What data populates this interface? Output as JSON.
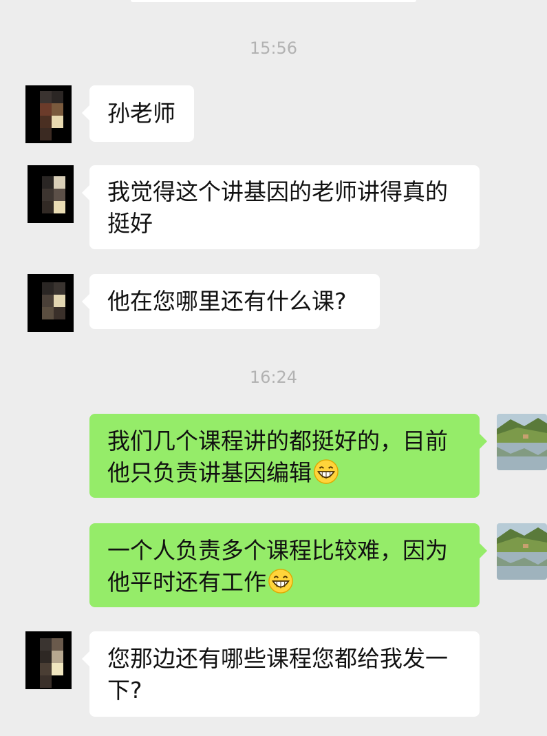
{
  "chat": {
    "timestamps": [
      "15:56",
      "16:24"
    ],
    "messages": [
      {
        "side": "incoming",
        "text": "孙老师"
      },
      {
        "side": "incoming",
        "line1": "我觉得这个讲基因的老师讲得真的",
        "line2": "挺好"
      },
      {
        "side": "incoming",
        "text": "他在您哪里还有什么课?"
      },
      {
        "side": "outgoing",
        "line1": "我们几个课程讲的都挺好的，目前",
        "line2": "他只负责讲基因编辑",
        "emoji": "grinning-face-emoji"
      },
      {
        "side": "outgoing",
        "line1": "一个人负责多个课程比较难，因为",
        "line2": "他平时还有工作",
        "emoji": "grinning-face-emoji"
      },
      {
        "side": "incoming",
        "line1": "您那边还有哪些课程您都给我发一",
        "line2": "下?"
      }
    ]
  },
  "colors": {
    "background": "#ededed",
    "incoming_bubble": "#ffffff",
    "outgoing_bubble": "#95ec69",
    "timestamp_text": "#b2b2b2"
  },
  "icons": {
    "contact_avatar": "pixelated-avatar-icon",
    "self_avatar": "landscape-avatar-icon"
  }
}
